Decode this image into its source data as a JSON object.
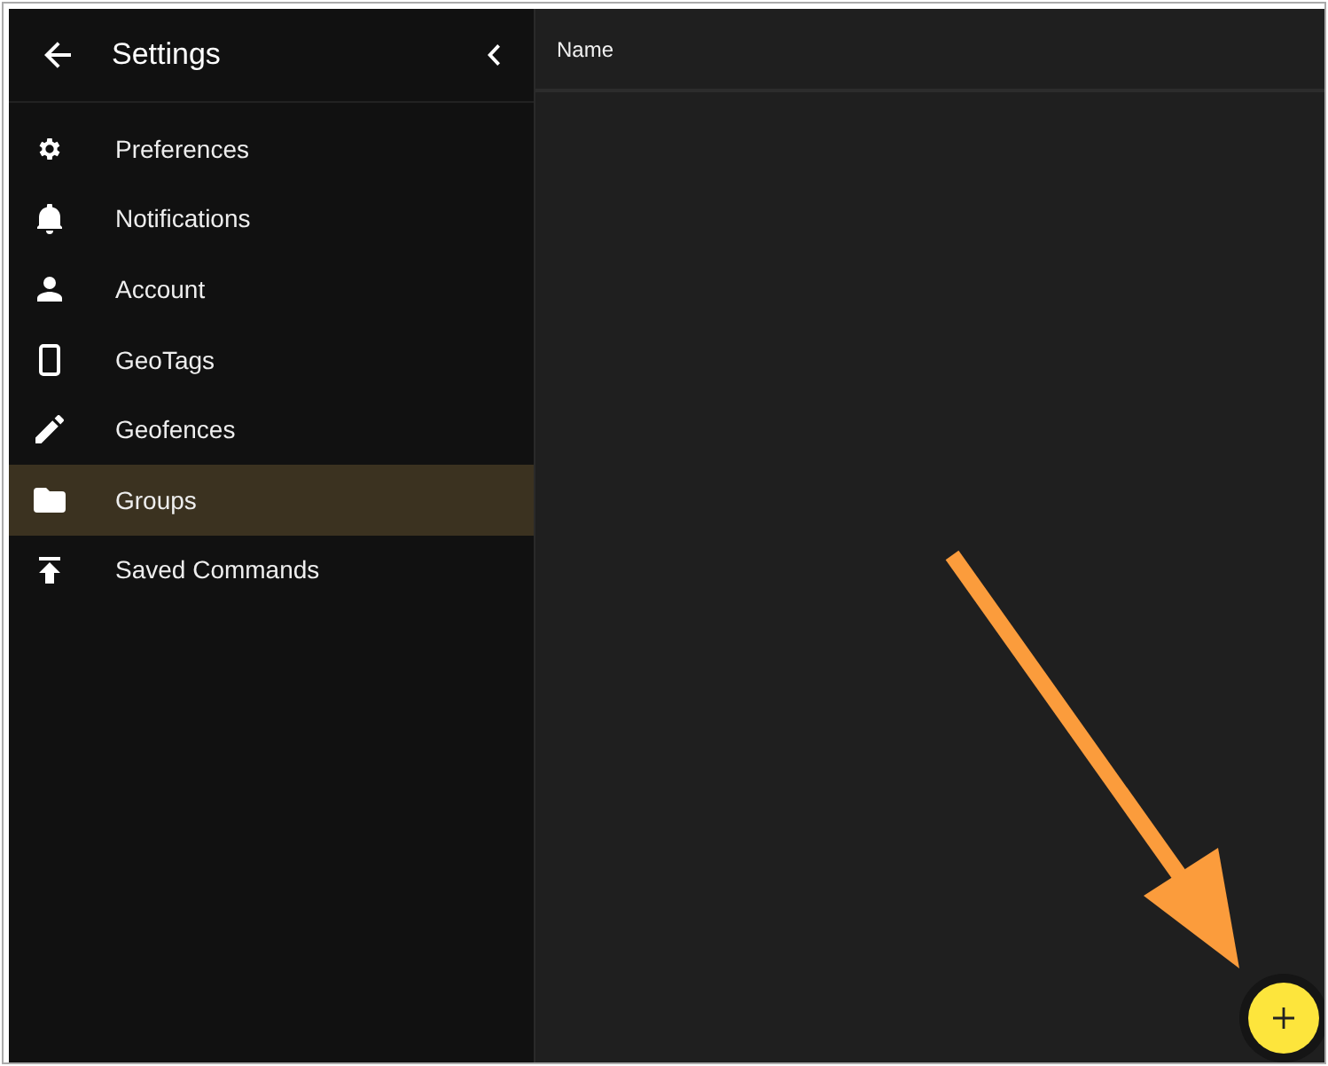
{
  "sidebar": {
    "title": "Settings",
    "items": [
      {
        "label": "Preferences",
        "selected": false
      },
      {
        "label": "Notifications",
        "selected": false
      },
      {
        "label": "Account",
        "selected": false
      },
      {
        "label": "GeoTags",
        "selected": false
      },
      {
        "label": "Geofences",
        "selected": false
      },
      {
        "label": "Groups",
        "selected": true
      },
      {
        "label": "Saved Commands",
        "selected": false
      }
    ]
  },
  "table": {
    "columns": [
      "Name"
    ]
  }
}
